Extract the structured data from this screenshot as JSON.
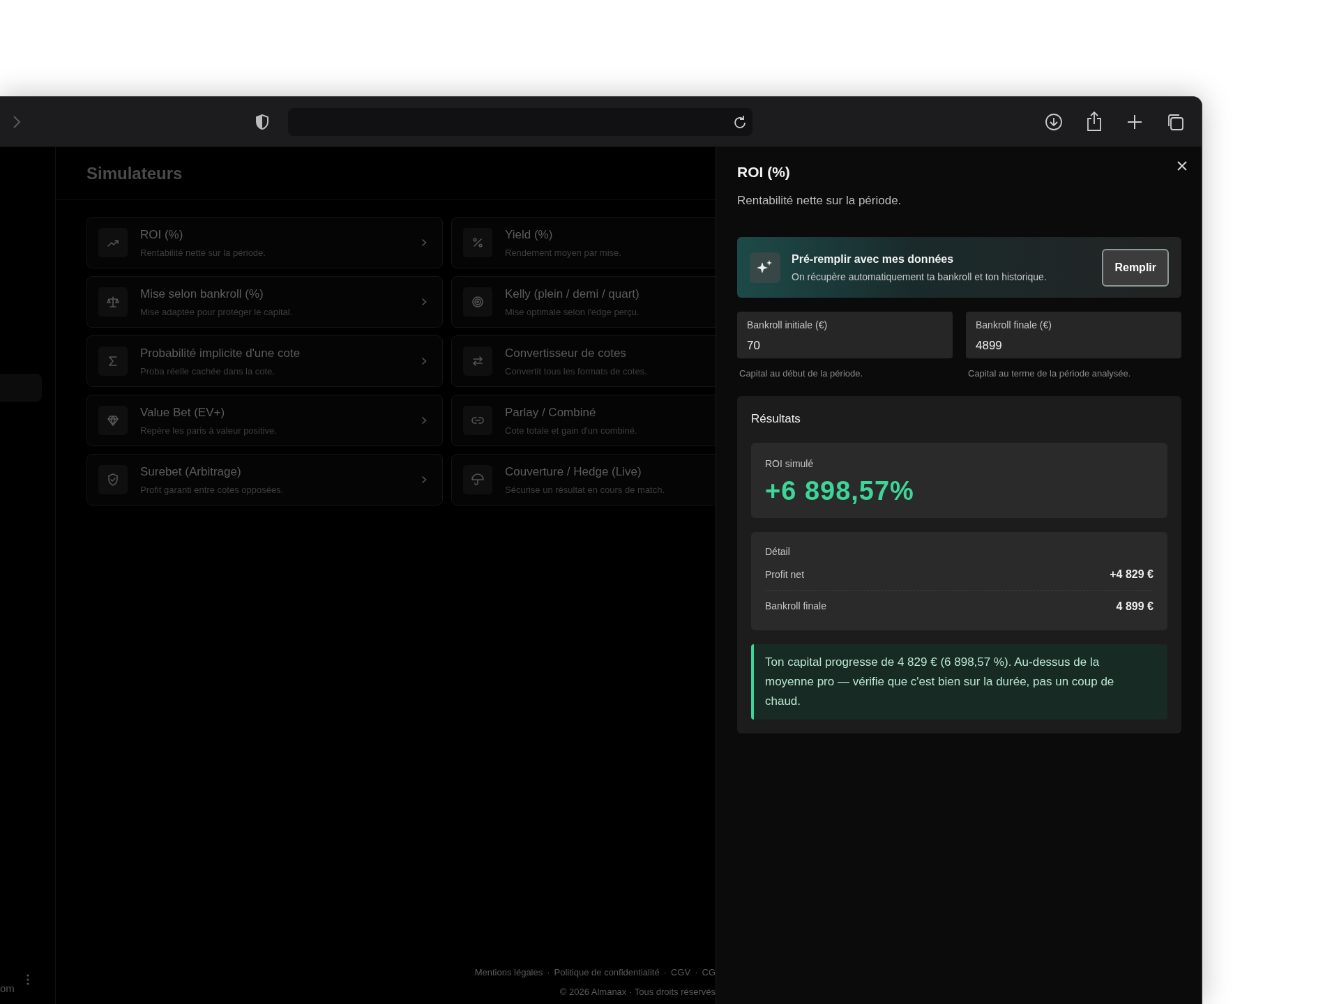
{
  "page_title": "Simulateurs",
  "simulators": [
    {
      "title": "ROI (%)",
      "description": "Rentabilité nette sur la période.",
      "arrow": true
    },
    {
      "title": "Yield (%)",
      "description": "Rendement moyen par mise."
    },
    {
      "title": "Mise selon bankroll (%)",
      "description": "Mise adaptée pour protéger le capital.",
      "arrow": true
    },
    {
      "title": "Kelly (plein / demi / quart)",
      "description": "Mise optimale selon l'edge perçu."
    },
    {
      "title": "Probabilité implicite d'une cote",
      "description": "Proba réelle cachée dans la cote.",
      "arrow": true
    },
    {
      "title": "Convertisseur de cotes",
      "description": "Convertit tous les formats de cotes."
    },
    {
      "title": "Value Bet (EV+)",
      "description": "Repère les paris à valeur positive.",
      "arrow": true
    },
    {
      "title": "Parlay / Combiné",
      "description": "Cote totale et gain d'un combiné."
    },
    {
      "title": "Surebet (Arbitrage)",
      "description": "Profit garanti entre cotes opposées.",
      "arrow": true
    },
    {
      "title": "Couverture / Hedge (Live)",
      "description": "Sécurise un résultat en cours de match."
    }
  ],
  "sidebar_footer_text": "om",
  "footer": {
    "separator": "·",
    "links": [
      "Mentions légales",
      "Politique de confidentialité",
      "CGV",
      "CG"
    ],
    "copyright": "© 2026 Almanax · Tous droits réservés"
  },
  "panel": {
    "title": "ROI (%)",
    "subtitle": "Rentabilité nette sur la période.",
    "prefill": {
      "title": "Pré-remplir avec mes données",
      "description": "On récupère automatiquement ta bankroll et ton historique.",
      "button": "Remplir"
    },
    "fields": [
      {
        "label": "Bankroll initiale (€)",
        "value": "70",
        "hint": "Capital au début de la période."
      },
      {
        "label": "Bankroll finale (€)",
        "value": "4899",
        "hint": "Capital au terme de la période analysée."
      }
    ],
    "results": {
      "title": "Résultats",
      "roi_label": "ROI simulé",
      "roi_value": "+6 898,57%",
      "detail_title": "Détail",
      "detail_rows": [
        {
          "label": "Profit net",
          "value": "+4 829 €"
        },
        {
          "label": "Bankroll finale",
          "value": "4 899 €"
        }
      ],
      "note": "Ton capital progresse de 4 829 € (6 898,57 %). Au-dessus de la moyenne pro — vérifie que c'est bien sur la durée, pas un coup de chaud."
    }
  }
}
